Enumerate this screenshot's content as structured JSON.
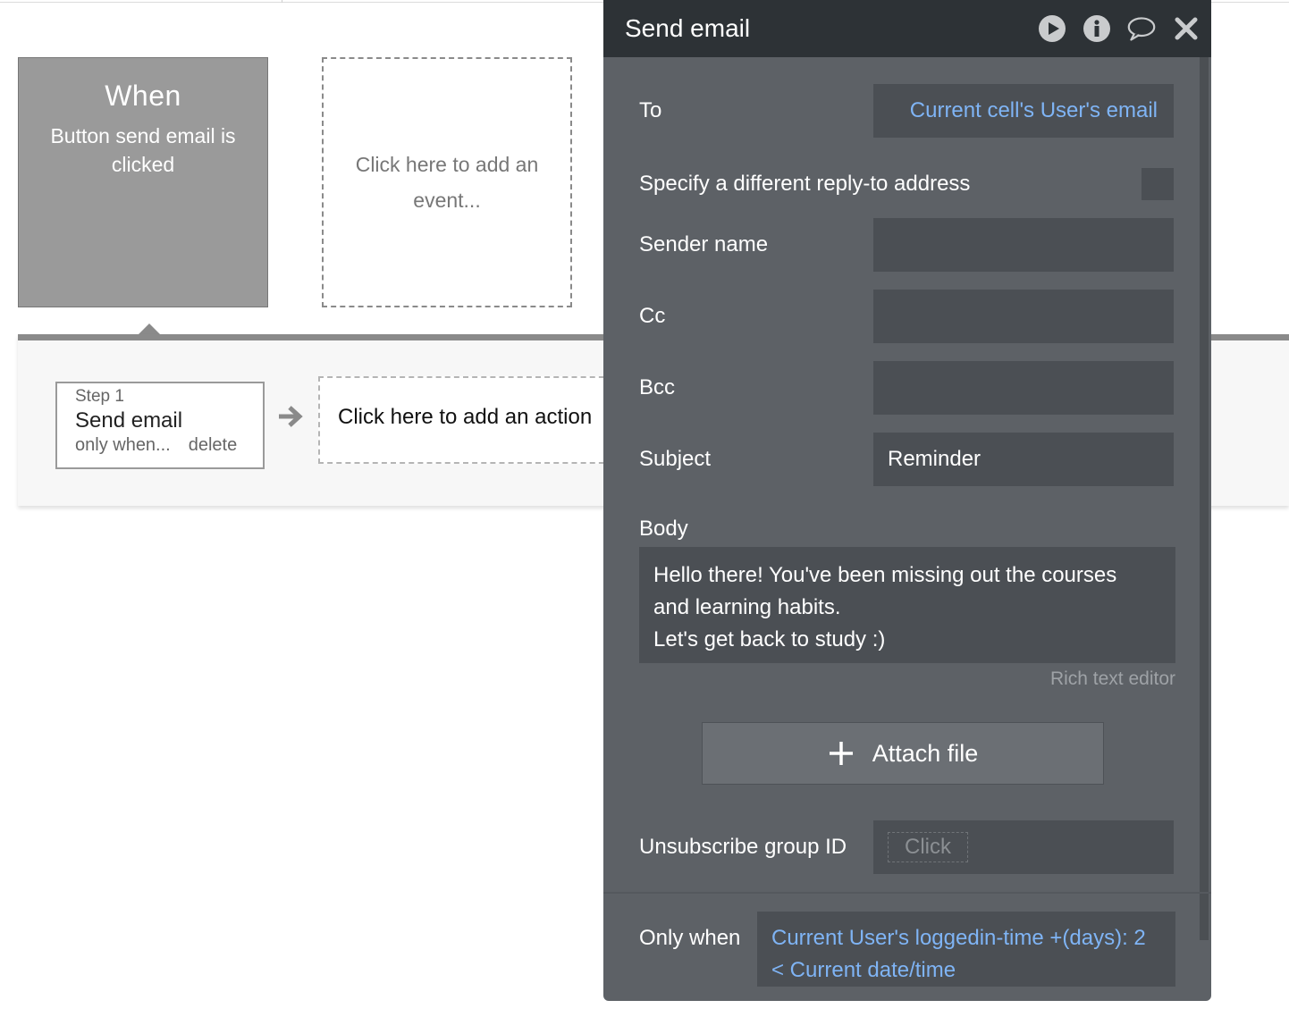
{
  "workflow": {
    "event": {
      "heading": "When",
      "description": "Button send email is clicked"
    },
    "add_event_placeholder": "Click here to add an event...",
    "step": {
      "number_label": "Step 1",
      "name": "Send email",
      "condition_link": "only when...",
      "delete_label": "delete"
    },
    "add_action_placeholder": "Click here to add an action"
  },
  "panel": {
    "title": "Send email",
    "icons": [
      "play-icon",
      "info-icon",
      "comment-icon",
      "close-icon"
    ],
    "fields": {
      "to": {
        "label": "To",
        "value": "Current cell's User's email"
      },
      "reply_to": {
        "label": "Specify a different reply-to address",
        "checked": false
      },
      "sender_name": {
        "label": "Sender name",
        "value": ""
      },
      "cc": {
        "label": "Cc",
        "value": ""
      },
      "bcc": {
        "label": "Bcc",
        "value": ""
      },
      "subject": {
        "label": "Subject",
        "value": "Reminder"
      },
      "body": {
        "label": "Body",
        "lines": [
          "Hello there! You've been missing out the courses",
          "and learning habits.",
          "Let's get back to study :)"
        ]
      },
      "rich_text_link": "Rich text editor",
      "attach_label": "Attach file",
      "unsubscribe": {
        "label": "Unsubscribe group ID",
        "placeholder": "Click"
      },
      "only_when": {
        "label": "Only when",
        "lines": [
          "Current User's loggedin-time +(days): 2",
          "< Current date/time"
        ]
      }
    },
    "colors": {
      "header_bg": "#2d3236",
      "panel_bg": "#5d6166",
      "field_bg": "#4b4f54",
      "link": "#7fb4f5"
    }
  }
}
